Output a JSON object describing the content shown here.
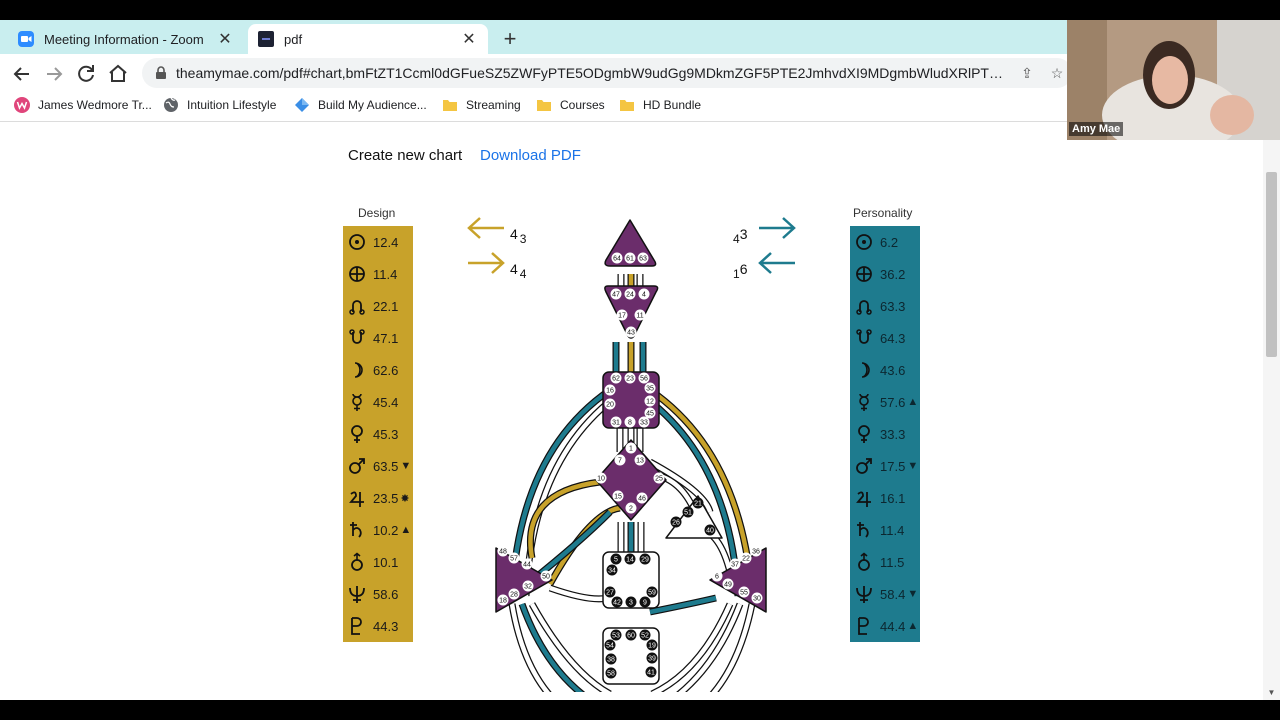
{
  "browser": {
    "tabs": [
      {
        "label": "Meeting Information - Zoom",
        "icon": "zoom-icon",
        "active": false
      },
      {
        "label": "pdf",
        "icon": "pdf-favicon-icon",
        "active": true
      }
    ],
    "close_glyph": "✕",
    "new_tab_glyph": "+",
    "url": "theamymae.com/pdf#chart,bmFtZT1Ccml0dGFueSZ5ZWFyPTE5ODgmbW9udGg9MDkmZGF5PTE2JmhvdXI9MDgmbWludXRlPTE0JmJ...",
    "bookmarks": [
      {
        "label": "James Wedmore Tr...",
        "icon": "w-brand-icon"
      },
      {
        "label": "Intuition Lifestyle",
        "icon": "globe-icon"
      },
      {
        "label": "Build My Audience...",
        "icon": "diamond-icon"
      },
      {
        "label": "Streaming",
        "icon": "folder-icon"
      },
      {
        "label": "Courses",
        "icon": "folder-icon"
      },
      {
        "label": "HD Bundle",
        "icon": "folder-icon"
      }
    ]
  },
  "page": {
    "create_label": "Create new chart",
    "download_label": "Download PDF"
  },
  "design": {
    "title": "Design",
    "color": "#c8a22a",
    "rows": [
      {
        "planet": "sun",
        "value": "12.4",
        "mark": ""
      },
      {
        "planet": "earth",
        "value": "11.4",
        "mark": ""
      },
      {
        "planet": "north-node",
        "value": "22.1",
        "mark": ""
      },
      {
        "planet": "south-node",
        "value": "47.1",
        "mark": ""
      },
      {
        "planet": "moon",
        "value": "62.6",
        "mark": ""
      },
      {
        "planet": "mercury",
        "value": "45.4",
        "mark": ""
      },
      {
        "planet": "venus",
        "value": "45.3",
        "mark": ""
      },
      {
        "planet": "mars",
        "value": "63.5",
        "mark": "▼"
      },
      {
        "planet": "jupiter",
        "value": "23.5",
        "mark": "✸"
      },
      {
        "planet": "saturn",
        "value": "10.2",
        "mark": "▲"
      },
      {
        "planet": "uranus",
        "value": "10.1",
        "mark": ""
      },
      {
        "planet": "neptune",
        "value": "58.6",
        "mark": ""
      },
      {
        "planet": "pluto",
        "value": "44.3",
        "mark": ""
      }
    ]
  },
  "personality": {
    "title": "Personality",
    "color": "#1e7b8e",
    "rows": [
      {
        "planet": "sun",
        "value": "6.2",
        "mark": ""
      },
      {
        "planet": "earth",
        "value": "36.2",
        "mark": ""
      },
      {
        "planet": "north-node",
        "value": "63.3",
        "mark": ""
      },
      {
        "planet": "south-node",
        "value": "64.3",
        "mark": ""
      },
      {
        "planet": "moon",
        "value": "43.6",
        "mark": ""
      },
      {
        "planet": "mercury",
        "value": "57.6",
        "mark": "▲"
      },
      {
        "planet": "venus",
        "value": "33.3",
        "mark": ""
      },
      {
        "planet": "mars",
        "value": "17.5",
        "mark": "▼"
      },
      {
        "planet": "jupiter",
        "value": "16.1",
        "mark": ""
      },
      {
        "planet": "saturn",
        "value": "11.4",
        "mark": ""
      },
      {
        "planet": "uranus",
        "value": "11.5",
        "mark": ""
      },
      {
        "planet": "neptune",
        "value": "58.4",
        "mark": "▼"
      },
      {
        "planet": "pluto",
        "value": "44.4",
        "mark": "▲"
      }
    ]
  },
  "arrows": {
    "design_top": {
      "main": "4",
      "sub": "3",
      "dir": "left"
    },
    "design_bottom": {
      "main": "4",
      "sub": "4",
      "dir": "right"
    },
    "personality_top": {
      "main": "3",
      "pre": "4",
      "dir": "right"
    },
    "personality_bottom": {
      "main": "6",
      "pre": "1",
      "dir": "left"
    }
  },
  "bodygraph": {
    "centers": {
      "head": {
        "gates": [
          "64",
          "61",
          "63"
        ],
        "defined": true
      },
      "ajna": {
        "gates": [
          "47",
          "24",
          "4",
          "17",
          "11",
          "43"
        ],
        "defined": true
      },
      "throat": {
        "gates": [
          "62",
          "23",
          "56",
          "16",
          "35",
          "20",
          "12",
          "45",
          "31",
          "8",
          "33"
        ],
        "defined": true
      },
      "g": {
        "gates": [
          "1",
          "7",
          "13",
          "10",
          "25",
          "15",
          "46",
          "2"
        ],
        "defined": true
      },
      "heart": {
        "gates": [
          "21",
          "51",
          "26",
          "40"
        ],
        "defined": false
      },
      "spleen": {
        "gates": [
          "48",
          "57",
          "44",
          "50",
          "32",
          "28",
          "18"
        ],
        "defined": true
      },
      "solar_plexus": {
        "gates": [
          "36",
          "22",
          "37",
          "6",
          "49",
          "55",
          "30"
        ],
        "defined": true
      },
      "sacral": {
        "gates": [
          "5",
          "14",
          "29",
          "34",
          "27",
          "59",
          "42",
          "3",
          "9"
        ],
        "defined": false
      },
      "root": {
        "gates": [
          "53",
          "60",
          "52",
          "54",
          "19",
          "38",
          "39",
          "58",
          "41"
        ],
        "defined": false
      }
    },
    "colors": {
      "defined": "#6b2d6b",
      "design": "#c8a22a",
      "personality": "#1e7b8e"
    }
  },
  "zoom": {
    "participant_name": "Amy Mae"
  }
}
